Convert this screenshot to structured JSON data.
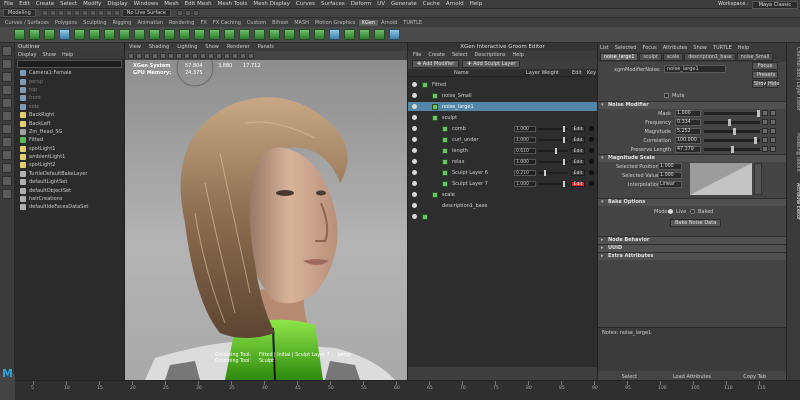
{
  "menubar": {
    "items": [
      "File",
      "Edit",
      "Create",
      "Select",
      "Modify",
      "Display",
      "Windows",
      "Mesh",
      "Edit Mesh",
      "Mesh Tools",
      "Mesh Display",
      "Curves",
      "Surfaces",
      "Deform",
      "UV",
      "Generate",
      "Cache",
      "Arnold",
      "Help"
    ],
    "workspace_label": "Workspace :",
    "workspace_value": "Maya Classic"
  },
  "statusline": {
    "mode": "Modeling",
    "live_surface": "No Live Surface"
  },
  "shelf": {
    "tabs": [
      "Curves / Surfaces",
      "Polygons",
      "Sculpting",
      "Rigging",
      "Animation",
      "Rendering",
      "FX",
      "FX Caching",
      "Custom",
      "Bifrost",
      "MASH",
      "Motion Graphics",
      "XGen",
      "Arnold",
      "TURTLE"
    ],
    "active": "XGen"
  },
  "outliner": {
    "title": "Outliner",
    "menu": [
      "Display",
      "Show",
      "Help"
    ],
    "items": [
      {
        "label": "Camera1:Female",
        "icon": "cam",
        "dim": false
      },
      {
        "label": "persp",
        "icon": "cam",
        "dim": true
      },
      {
        "label": "top",
        "icon": "cam",
        "dim": true
      },
      {
        "label": "front",
        "icon": "cam",
        "dim": true
      },
      {
        "label": "side",
        "icon": "cam",
        "dim": true
      },
      {
        "label": "BackRight",
        "icon": "light",
        "dim": false
      },
      {
        "label": "BackLeft",
        "icon": "light",
        "dim": false
      },
      {
        "label": "Zm_Head_SG",
        "icon": "grp",
        "dim": false
      },
      {
        "label": "Fitted",
        "icon": "hair",
        "dim": false
      },
      {
        "label": "spotLight1",
        "icon": "light",
        "dim": false
      },
      {
        "label": "ambientLight1",
        "icon": "light",
        "dim": false
      },
      {
        "label": "spotLight2",
        "icon": "light",
        "dim": false
      },
      {
        "label": "TurtleDefaultBakeLayer",
        "icon": "set",
        "dim": false
      },
      {
        "label": "defaultLightSet",
        "icon": "set",
        "dim": false
      },
      {
        "label": "defaultObjectSet",
        "icon": "set",
        "dim": false
      },
      {
        "label": "hairCreations",
        "icon": "set",
        "dim": false
      },
      {
        "label": "defaultIdeFacesDataSet",
        "icon": "set",
        "dim": false
      }
    ]
  },
  "viewport": {
    "menu": [
      "View",
      "Shading",
      "Lighting",
      "Show",
      "Renderer",
      "Panels"
    ],
    "hud_labels": [
      "XGen System",
      "GPU Memory:"
    ],
    "hud_col1": [
      "57.804",
      "24.375"
    ],
    "hud_col2": [
      "",
      "3,880"
    ],
    "hud_col3": [
      "",
      "17.712"
    ],
    "bottom_left": [
      "Grooming Tool:",
      "Grooming Tool:"
    ],
    "bottom_mid": [
      "Fitted | Initial | Sculpt Layer 7",
      "Sculpt"
    ],
    "bottom_right": [
      "",
      "persp"
    ]
  },
  "xgen": {
    "title": "XGen Interactive Groom Editor",
    "menu": [
      "File",
      "Create",
      "Select",
      "Descriptions",
      "Help"
    ],
    "add_modifier": "Add Modifier",
    "add_sculpt_layer": "Add Sculpt Layer",
    "col_name": "Name",
    "col_layer_weight": "Layer Weight",
    "col_edit": "Edit",
    "col_key": "Key",
    "rows": [
      {
        "label": "Fitted",
        "indent": 0,
        "selected": false,
        "icon": true
      },
      {
        "label": "noise_Small",
        "indent": 1,
        "selected": false,
        "icon": true
      },
      {
        "label": "noise_large1",
        "indent": 1,
        "selected": true,
        "icon": true
      },
      {
        "label": "sculpt",
        "indent": 1,
        "selected": false,
        "icon": true
      },
      {
        "label": "comb",
        "indent": 2,
        "selected": false,
        "icon": true,
        "value": "1.000",
        "knob": 0.9,
        "edit": "Edit",
        "red": false
      },
      {
        "label": "curl_under",
        "indent": 2,
        "selected": false,
        "icon": true,
        "value": "1.000",
        "knob": 0.9,
        "edit": "Edit",
        "red": false
      },
      {
        "label": "length",
        "indent": 2,
        "selected": false,
        "icon": true,
        "value": "0.610",
        "knob": 0.6,
        "edit": "Edit",
        "red": false
      },
      {
        "label": "relax",
        "indent": 2,
        "selected": false,
        "icon": true,
        "value": "1.000",
        "knob": 0.9,
        "edit": "Edit",
        "red": false
      },
      {
        "label": "Sculpt Layer 6",
        "indent": 2,
        "selected": false,
        "icon": true,
        "value": "0.210",
        "knob": 0.2,
        "edit": "Edit",
        "red": false
      },
      {
        "label": "Sculpt Layer 7",
        "indent": 2,
        "selected": false,
        "icon": true,
        "value": "1.000",
        "knob": 0.9,
        "edit": "Edit",
        "red": true
      },
      {
        "label": "scale",
        "indent": 1,
        "selected": false,
        "icon": true
      },
      {
        "label": "description1_base",
        "indent": 1,
        "selected": false,
        "icon": false
      },
      {
        "label": "",
        "indent": 0,
        "selected": false,
        "icon": true
      }
    ]
  },
  "attr": {
    "tabs": [
      "List",
      "Selected",
      "Focus",
      "Attributes",
      "Show",
      "TURTLE",
      "Help"
    ],
    "node_tabs": [
      "noise_large1",
      "sculpt",
      "scale",
      "description1_base",
      "noise_Small"
    ],
    "node_field": "noise_large1",
    "modifier_label": "xgmModifierNoise:",
    "focus_btn": "Focus",
    "presets_btn": "Presets",
    "show_btn": "Show",
    "hide_btn": "Hide",
    "mute_label": "Mute",
    "noise_section": "Noise Modifier",
    "noise_attrs": [
      {
        "label": "Mask",
        "value": "1.000",
        "knob": 1.0
      },
      {
        "label": "Frequency",
        "value": "0.334",
        "knob": 0.45
      },
      {
        "label": "Magnitude",
        "value": "5.252",
        "knob": 0.55
      },
      {
        "label": "Correlation",
        "value": "100.000",
        "knob": 0.95
      },
      {
        "label": "Preserve Length",
        "value": "47.370",
        "knob": 0.5
      }
    ],
    "magnitude_section": "Magnitude Scale",
    "selected_position_label": "Selected Position",
    "selected_position": "1.000",
    "selected_value_label": "Selected Value",
    "selected_value": "1.000",
    "interpolation_label": "Interpolation",
    "interpolation": "Linear",
    "bake_section": "Bake Options",
    "mode_label": "Mode:",
    "mode_live": "Live",
    "mode_baked": "Baked",
    "bake_btn": "Bake Noise Data",
    "collapsed_sections": [
      "Node Behavior",
      "UUID",
      "Extra Attributes"
    ],
    "notes_label": "Notes: noise_large1",
    "footer": [
      "Select",
      "Load Attributes",
      "Copy Tab"
    ]
  },
  "side_tabs": [
    "Channel Box / Layer Editor",
    "Modeling Toolkit",
    "Attribute Editor"
  ],
  "timeline": {
    "numbers": [
      "5",
      "10",
      "15",
      "20",
      "25",
      "30",
      "35",
      "40",
      "45",
      "50",
      "55",
      "60",
      "65",
      "70",
      "75",
      "80",
      "85",
      "90",
      "95",
      "100",
      "105",
      "110",
      "115"
    ]
  },
  "colors": {
    "accent_selected": "#5285a6",
    "red_edit": "#d82a2a",
    "shelf_green": "#6fbf6a"
  }
}
